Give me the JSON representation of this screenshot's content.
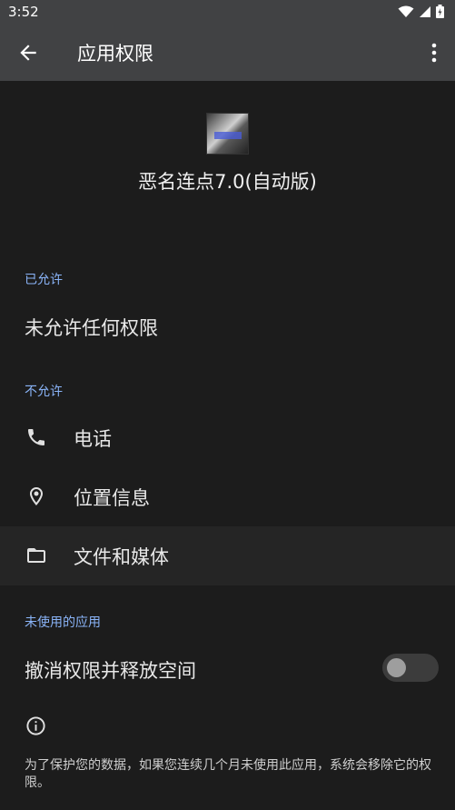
{
  "status_bar": {
    "time": "3:52"
  },
  "app_bar": {
    "title": "应用权限"
  },
  "app": {
    "name": "恶名连点7.0(自动版)"
  },
  "sections": {
    "allowed": {
      "label": "已允许",
      "empty_text": "未允许任何权限"
    },
    "not_allowed": {
      "label": "不允许",
      "items": [
        {
          "label": "电话",
          "icon": "phone-icon"
        },
        {
          "label": "位置信息",
          "icon": "location-icon"
        },
        {
          "label": "文件和媒体",
          "icon": "folder-icon"
        }
      ]
    },
    "unused_apps": {
      "label": "未使用的应用",
      "setting_label": "撤消权限并释放空间",
      "toggle_on": false,
      "footnote": "为了保护您的数据，如果您连续几个月未使用此应用，系统会移除它的权限。"
    }
  },
  "colors": {
    "accent": "#8ab4f8",
    "bar": "#414244",
    "background": "#1c1c1c"
  }
}
